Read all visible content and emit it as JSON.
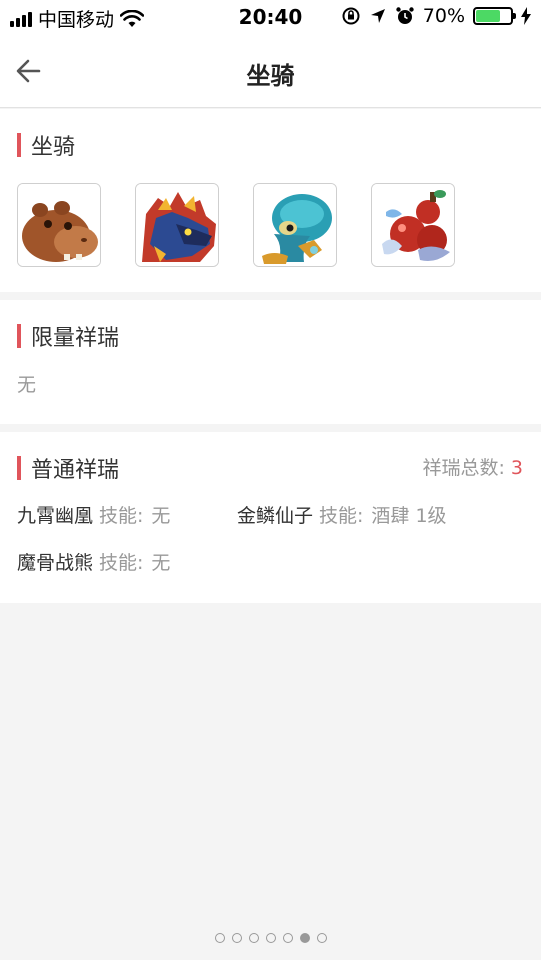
{
  "status_bar": {
    "carrier": "中国移动",
    "time": "20:40",
    "battery_percent": "70%",
    "battery_level": 0.7,
    "colors": {
      "battery_fill": "#4cd964"
    }
  },
  "nav": {
    "title": "坐骑",
    "back_icon": "arrow-left-icon"
  },
  "mounts_section": {
    "title": "坐骑",
    "mounts": [
      {
        "icon": "hippo-mount-icon"
      },
      {
        "icon": "dragon-mount-icon"
      },
      {
        "icon": "turtle-mount-icon"
      },
      {
        "icon": "gourd-mount-icon"
      }
    ]
  },
  "limited_section": {
    "title": "限量祥瑞",
    "empty_text": "无"
  },
  "normal_section": {
    "title": "普通祥瑞",
    "total_label": "祥瑞总数:",
    "total_value": "3",
    "items": [
      {
        "name": "九霄幽凰",
        "skill_label": "技能:",
        "skill_value": "无"
      },
      {
        "name": "金鳞仙子",
        "skill_label": "技能:",
        "skill_value": "酒肆 1级"
      },
      {
        "name": "魔骨战熊",
        "skill_label": "技能:",
        "skill_value": "无"
      }
    ]
  },
  "pager": {
    "total": 7,
    "active_index": 5
  },
  "colors": {
    "accent": "#e0555b",
    "muted": "#999999"
  }
}
